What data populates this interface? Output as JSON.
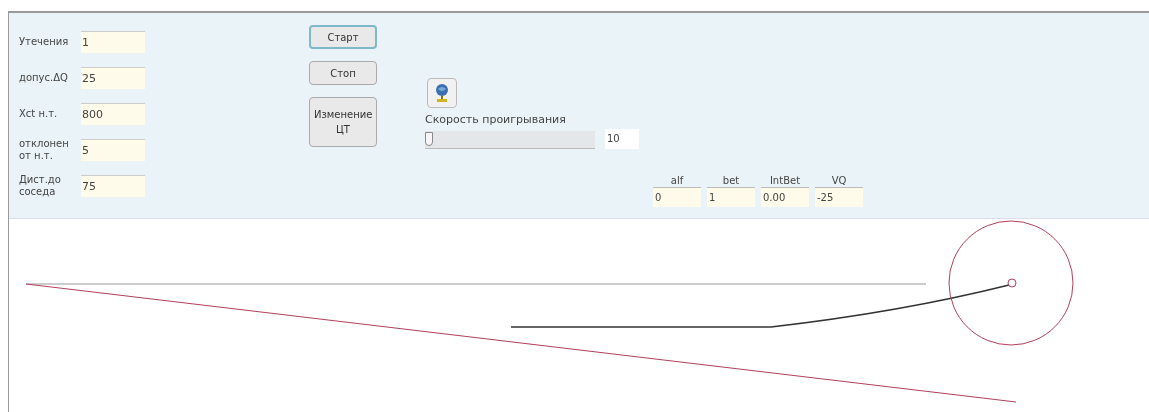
{
  "fields": [
    {
      "label": "Утечения",
      "value": "1"
    },
    {
      "label": "допус.ΔQ",
      "value": "25"
    },
    {
      "label": "Xct н.т.",
      "value": "800"
    },
    {
      "label": "отклонен от н.т.",
      "value": "5"
    },
    {
      "label": "Дист.до соседа",
      "value": "75"
    }
  ],
  "buttons": [
    {
      "label": "Старт",
      "selected": true
    },
    {
      "label": "Стоп",
      "selected": false
    },
    {
      "label": "Изменение ЦТ",
      "selected": false
    }
  ],
  "speed": {
    "label": "Скорость проигрывания",
    "level": 0,
    "value": "10"
  },
  "params": [
    {
      "label": "alf",
      "value": "0"
    },
    {
      "label": "bet",
      "value": "1"
    },
    {
      "label": "IntBet",
      "value": "0.00"
    },
    {
      "label": "VQ",
      "value": "-25"
    }
  ]
}
